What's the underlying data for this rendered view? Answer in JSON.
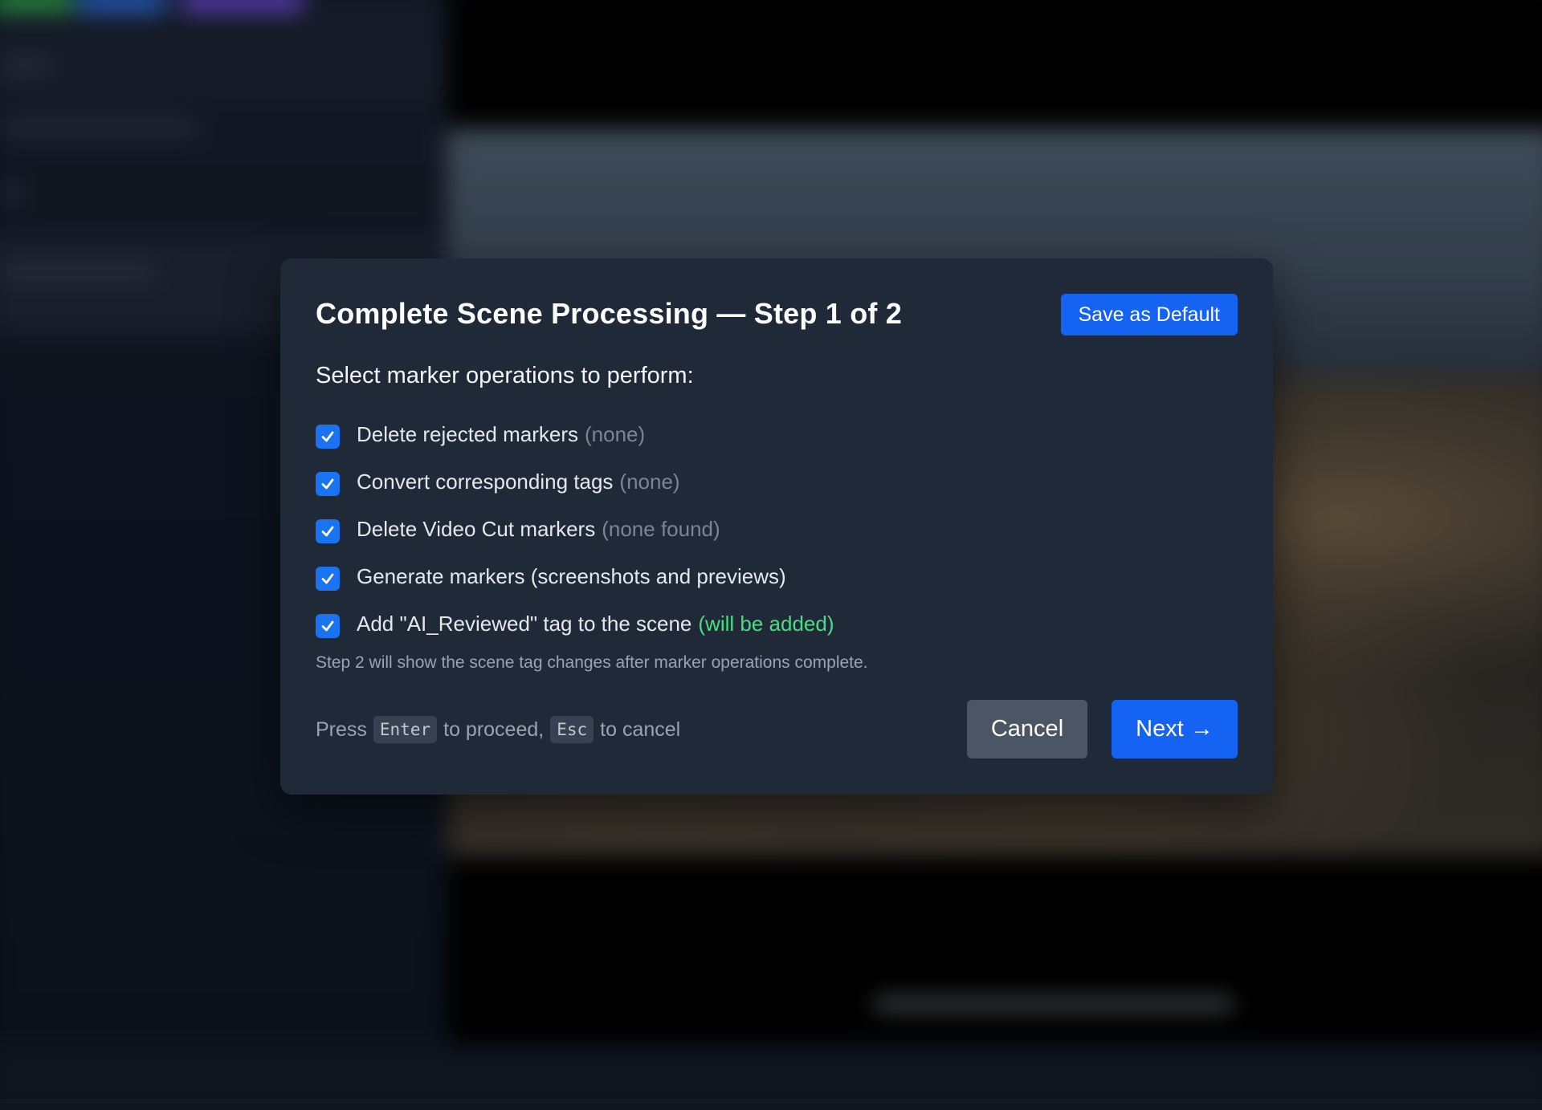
{
  "dialog": {
    "title": "Complete Scene Processing — Step 1 of 2",
    "save_default_label": "Save as Default",
    "section_label": "Select marker operations to perform:",
    "options": [
      {
        "label": "Delete rejected markers",
        "status": "(none)",
        "checked": true
      },
      {
        "label": "Convert corresponding tags",
        "status": "(none)",
        "checked": true
      },
      {
        "label": "Delete Video Cut markers",
        "status": "(none found)",
        "checked": true
      },
      {
        "label": "Generate markers (screenshots and previews)",
        "status": "",
        "checked": true
      },
      {
        "label": "Add \"AI_Reviewed\" tag to the scene",
        "status": "(will be added)",
        "checked": true
      }
    ],
    "note": "Step 2 will show the scene tag changes after marker operations complete.",
    "hint": {
      "press": "Press",
      "enter_key": "Enter",
      "to_proceed": "to proceed,",
      "esc_key": "Esc",
      "to_cancel": "to cancel"
    },
    "cancel_label": "Cancel",
    "next_label": "Next →"
  },
  "colors": {
    "accent": "#1463f3",
    "checkbox": "#1a73f0",
    "status_muted": "#7c8594",
    "status_positive": "#4ade80",
    "dialog_bg": "#1f2937"
  },
  "icons": {
    "checkbox": "check-icon"
  }
}
